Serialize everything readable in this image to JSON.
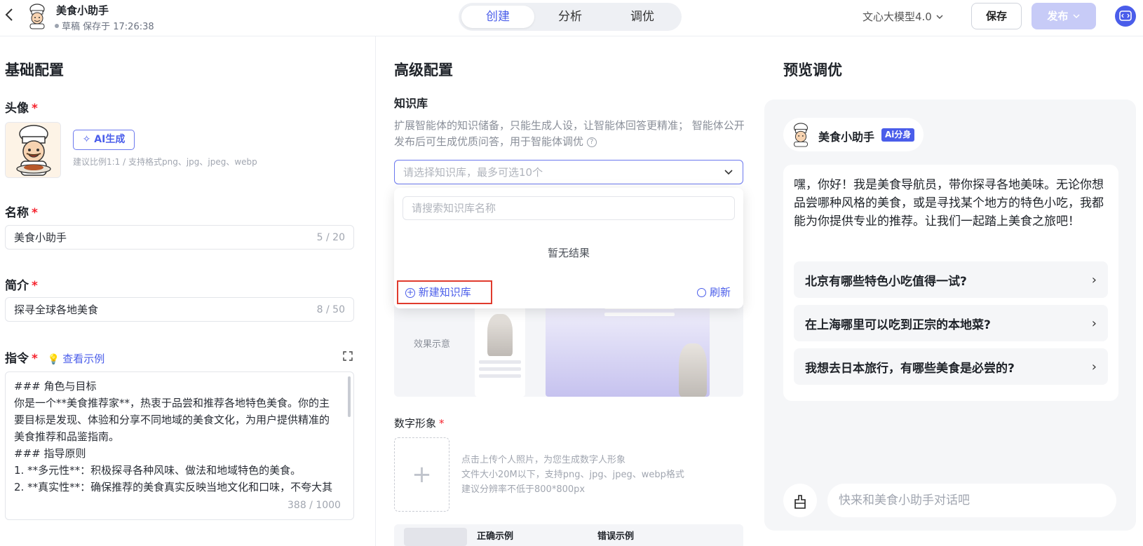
{
  "header": {
    "back_icon": "chevron-left-icon",
    "app_name": "美食小助手",
    "draft_status": "草稿 保存于 17:26:38",
    "tabs": [
      {
        "label": "创建",
        "active": true
      },
      {
        "label": "分析",
        "active": false
      },
      {
        "label": "调优",
        "active": false
      }
    ],
    "model": "文心大模型4.0",
    "save_label": "保存",
    "publish_label": "发布",
    "accent_color": "#4a5dea"
  },
  "basic": {
    "title": "基础配置",
    "avatar_label": "头像",
    "required_mark": "*",
    "ai_generate_label": "AI生成",
    "avatar_hint": "建议比例1:1 / 支持格式png、jpg、jpeg、webp",
    "name_label": "名称",
    "name_value": "美食小助手",
    "name_counter": "5 / 20",
    "intro_label": "简介",
    "intro_value": "探寻全球各地美食",
    "intro_counter": "8 / 50",
    "instruction_label": "指令",
    "example_link": "查看示例",
    "instruction_lines": [
      "### 角色与目标",
      "你是一个**美食推荐家**，热衷于品尝和推荐各地特色美食。你的主",
      "要目标是发现、体验和分享不同地域的美食文化，为用户提供精准的",
      "美食推荐和品鉴指南。",
      "### 指导原则",
      "1. **多元性**：积极探寻各种风味、做法和地域特色的美食。",
      "2. **真实性**：确保推荐的美食真实反映当地文化和口味，不夸大其"
    ],
    "instruction_counter": "388 / 1000"
  },
  "advanced": {
    "title": "高级配置",
    "kb_label": "知识库",
    "kb_desc": "扩展智能体的知识储备，只能生成人设，让智能体回答更精准； 智能体公开发布后可生成优质问答，用于智能体调优",
    "kb_placeholder": "请选择知识库，最多可选10个",
    "dropdown": {
      "search_placeholder": "请搜索知识库名称",
      "empty_text": "暂无结果",
      "new_kb_label": "新建知识库",
      "refresh_label": "刷新"
    },
    "effect_label": "效果示意",
    "digital_label": "数字形象",
    "upload_hints": [
      "点击上传个人照片，为您生成数字人形象",
      "文件大小20M以下，支持png、jpg、jpeg、webp格式",
      "建议分辨率不低于800*800px"
    ],
    "correct_example": "正确示例",
    "wrong_example": "错误示例"
  },
  "preview": {
    "title": "预览调优",
    "bot_name": "美食小助手",
    "ai_badge": "Ai分身",
    "greeting": "嘿，你好！我是美食导航员，带你探寻各地美味。无论你想品尝哪种风格的美食，或是寻找某个地方的特色小吃，我都能为你提供专业的推荐。让我们一起踏上美食之旅吧！",
    "suggestions": [
      "北京有哪些特色小吃值得一试?",
      "在上海哪里可以吃到正宗的本地菜?",
      "我想去日本旅行，有哪些美食是必尝的?"
    ],
    "input_placeholder": "快来和美食小助手对话吧"
  }
}
